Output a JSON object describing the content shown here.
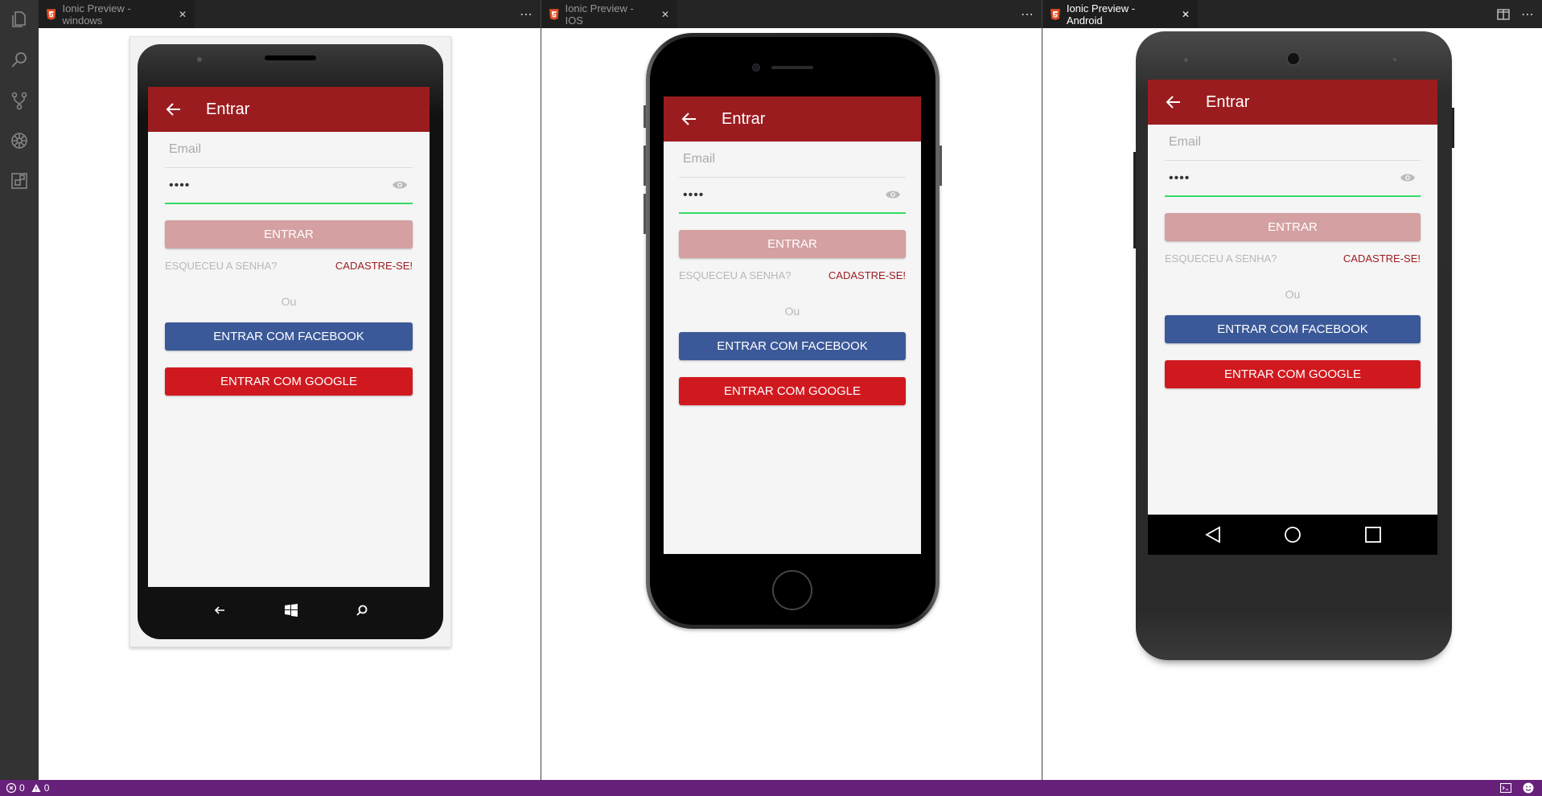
{
  "editors": [
    {
      "tab_title": "Ionic Preview - windows",
      "platform": "windows"
    },
    {
      "tab_title": "Ionic Preview - IOS",
      "platform": "ios"
    },
    {
      "tab_title": "Ionic Preview - Android",
      "platform": "android"
    }
  ],
  "app": {
    "page_title": "Entrar",
    "email_placeholder": "Email",
    "password_mask": "••••",
    "login_label": "ENTRAR",
    "forgot_label": "ESQUECEU A SENHA?",
    "forgot_label_ios": "ESQUECEU A SENHA?",
    "signup_label": "CADASTRE-SE!",
    "or_label": "Ou",
    "facebook_label": "ENTRAR COM FACEBOOK",
    "google_label": "ENTRAR COM GOOGLE"
  },
  "status": {
    "errors": "0",
    "warnings": "0"
  },
  "colors": {
    "toolbar": "#9b1c1f",
    "login_button": "#d4a0a1",
    "facebook": "#3b5998",
    "google": "#d0191f",
    "focus_line": "#32db64",
    "status_bar": "#68217a"
  },
  "icons": {
    "activity": [
      "files-icon",
      "search-icon",
      "source-control-icon",
      "debug-icon",
      "extensions-icon"
    ],
    "tab_file": "html5-icon",
    "tab_more": "more-icon",
    "split": "split-editor-icon"
  }
}
